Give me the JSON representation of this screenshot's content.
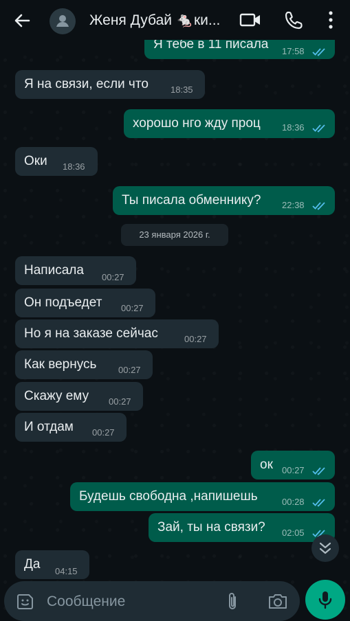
{
  "header": {
    "contact_name": "Женя Дубай 🐁ки...",
    "icons": [
      "back-arrow-icon",
      "avatar-placeholder-icon",
      "video-call-icon",
      "voice-call-icon",
      "more-menu-icon"
    ]
  },
  "messages": [
    {
      "dir": "out",
      "text": "Я тебе в 11 писала",
      "time": "17:58",
      "read": true
    },
    {
      "dir": "in",
      "text": "Я на связи, если что",
      "time": "18:35"
    },
    {
      "dir": "out",
      "text": "хорошо нго жду проц",
      "time": "18:36",
      "read": true
    },
    {
      "dir": "in",
      "text": "Оки",
      "time": "18:36"
    },
    {
      "dir": "out",
      "text": "Ты писала обменнику?",
      "time": "22:38",
      "read": true
    },
    {
      "dir": "in",
      "text": "Написала",
      "time": "00:27"
    },
    {
      "dir": "in",
      "text": "Он подъедет",
      "time": "00:27"
    },
    {
      "dir": "in",
      "text": "Но я на заказе сейчас",
      "time": "00:27"
    },
    {
      "dir": "in",
      "text": "Как вернусь",
      "time": "00:27"
    },
    {
      "dir": "in",
      "text": "Скажу ему",
      "time": "00:27"
    },
    {
      "dir": "in",
      "text": "И отдам",
      "time": "00:27"
    },
    {
      "dir": "out",
      "text": "ок",
      "time": "00:27",
      "read": true
    },
    {
      "dir": "out",
      "text": "Будешь свободна ,напишешь",
      "time": "00:28",
      "read": true
    },
    {
      "dir": "out",
      "text": "Зай, ты на связи?",
      "time": "02:05",
      "read": true
    },
    {
      "dir": "in",
      "text": "Да",
      "time": "04:15"
    }
  ],
  "date_separator": "23 января 2026 г.",
  "composer": {
    "placeholder": "Сообщение"
  },
  "colors": {
    "background": "#0b1014",
    "incoming_bubble": "#1f2c34",
    "outgoing_bubble": "#005c4b",
    "read_ticks": "#53bdeb",
    "accent": "#00a884"
  }
}
